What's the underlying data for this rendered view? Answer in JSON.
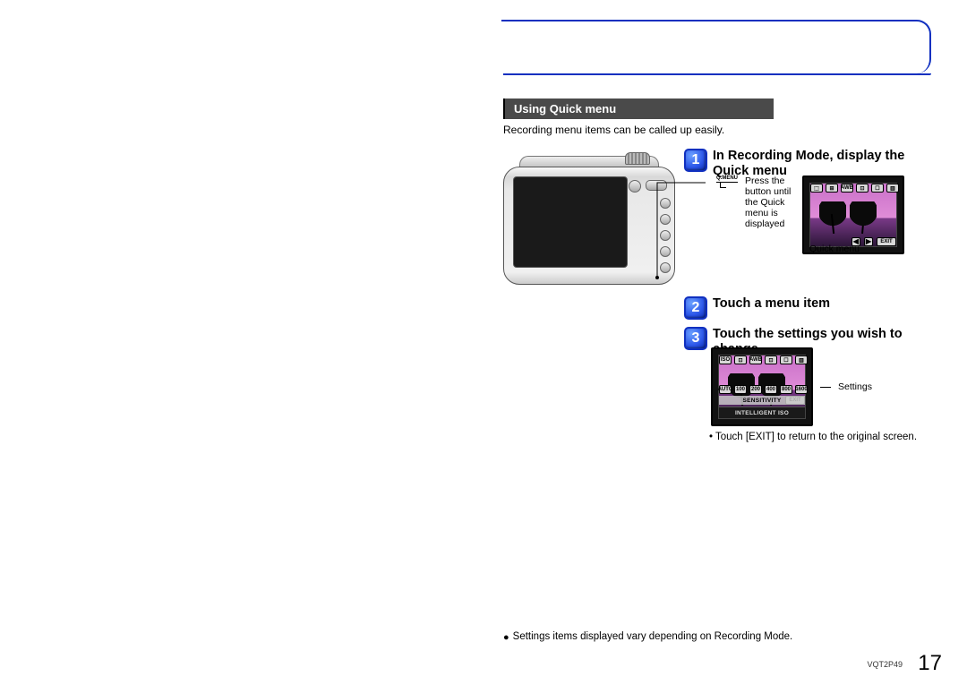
{
  "section": {
    "title": "Using Quick menu"
  },
  "intro": "Recording menu items can be called up easily.",
  "steps": {
    "s1": {
      "num": "1",
      "title": "In Recording Mode, display the Quick menu"
    },
    "s2": {
      "num": "2",
      "title": "Touch a menu item"
    },
    "s3": {
      "num": "3",
      "title": "Touch the settings you wish to change"
    }
  },
  "qmenu": {
    "button_label": "Q.MENU",
    "press_text": "Press the button until the Quick menu is displayed",
    "caption": "Quick menu"
  },
  "preview_icons": {
    "top": [
      "⬚",
      "⊞",
      "AWB",
      "⊡",
      "☐",
      "▥"
    ],
    "nav_prev": "◀",
    "nav_next": "▶",
    "exit": "EXIT"
  },
  "preview2": {
    "top": [
      "ISO",
      "⊡",
      "AWB",
      "⊡",
      "☐",
      "▥"
    ],
    "mid": [
      "AUTO",
      "100",
      "200",
      "400",
      "800",
      "1600"
    ],
    "sensitivity": "SENSITIVITY",
    "iiso": "INTELLIGENT ISO",
    "label": "Settings"
  },
  "return_note": "• Touch [EXIT] to return to the original screen.",
  "footnote": "Settings items displayed vary depending on Recording Mode.",
  "doc_id": "VQT2P49",
  "page_number": "17"
}
